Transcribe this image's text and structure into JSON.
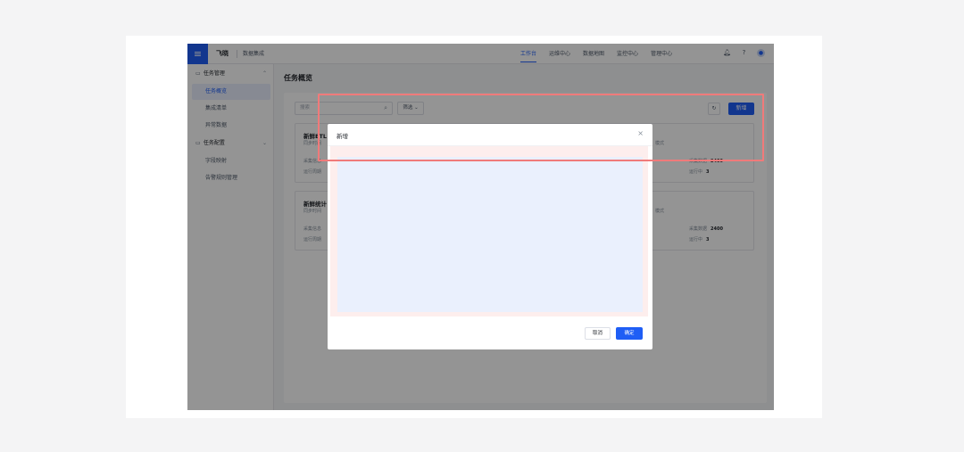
{
  "header": {
    "brand": "飞晓",
    "product": "数据集成",
    "nav": [
      "工作台",
      "运维中心",
      "数据地图",
      "监控中心",
      "管理中心"
    ],
    "icons": [
      "bell-icon",
      "help-icon",
      "user-icon"
    ]
  },
  "sidebar": {
    "groups": [
      {
        "label": "任务管理",
        "icon": "folder-icon",
        "expanded": true,
        "items": [
          "任务概览",
          "集成清单",
          "异常数据"
        ]
      },
      {
        "label": "任务配置",
        "icon": "folder-icon",
        "expanded": false,
        "items": [
          "字段映射",
          "告警规则管理"
        ]
      }
    ],
    "active_item": "任务概览"
  },
  "main": {
    "title": "任务概览",
    "search_placeholder": "搜索",
    "filter_label": "筛选",
    "refresh_icon": "refresh-icon",
    "add_label": "新增",
    "cards": [
      {
        "title": "新鲜ETL",
        "subtitle": "同步时间",
        "row1": "采集信息",
        "row2": "运行周期",
        "mode": "模式",
        "stat1_label": "采集数据",
        "stat1_value": "2400",
        "stat2_label": "运行中",
        "stat2_value": "3"
      },
      {
        "title": "新鲜统计",
        "subtitle": "同步时间",
        "row1": "采集信息",
        "row2": "运行周期",
        "mode": "模式",
        "stat1_label": "采集数据",
        "stat1_value": "2400",
        "stat2_label": "运行中",
        "stat2_value": "3"
      }
    ]
  },
  "dialog": {
    "title": "新增",
    "close_glyph": "×",
    "cancel_label": "取消",
    "ok_label": "确定"
  },
  "colors": {
    "primary": "#1f5ef5",
    "highlight": "#f07a7a",
    "body_outer": "#fdeeed",
    "body_inner": "#eaf0fd"
  }
}
